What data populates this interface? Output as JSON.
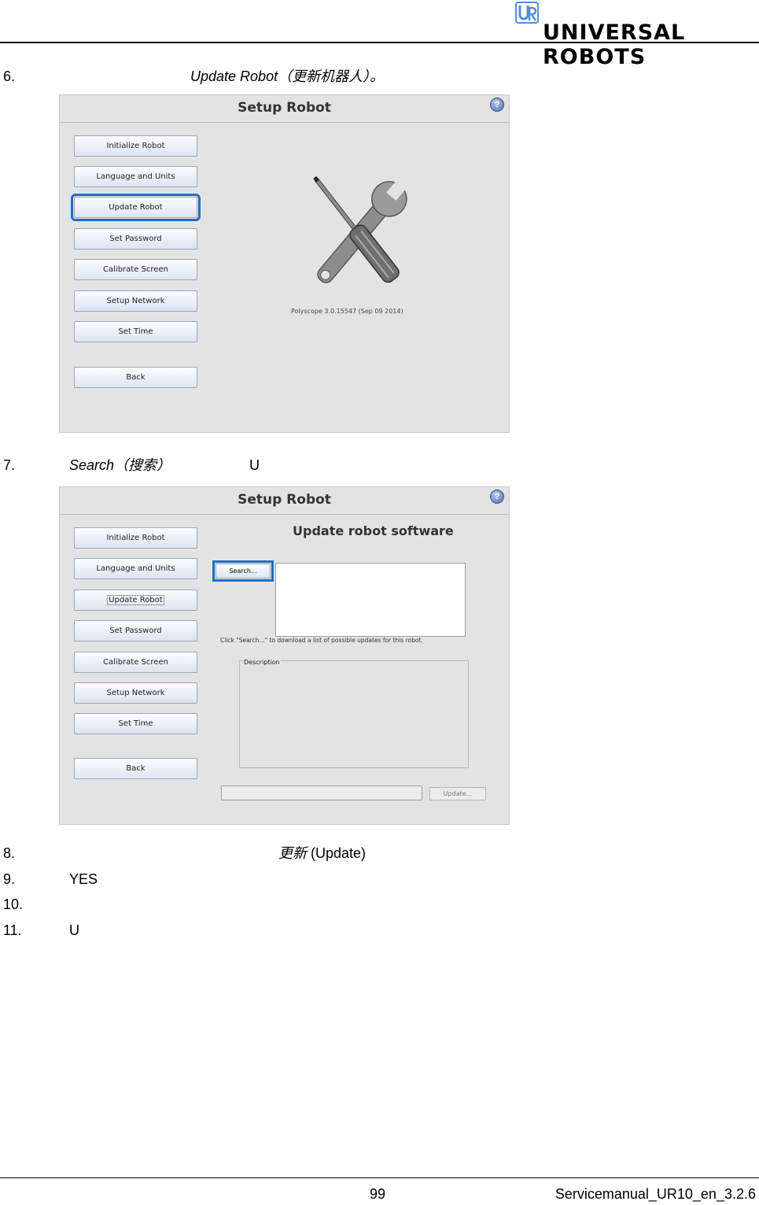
{
  "header": {
    "brand": "UNIVERSAL ROBOTS",
    "logo_icon": "ur-logo-icon"
  },
  "steps": {
    "s6": {
      "num": "6.",
      "italic": "Update Robot（更新机器人）。"
    },
    "s7": {
      "num": "7.",
      "italic": "Search（搜索）",
      "tail": "U"
    },
    "s8": {
      "num": "8.",
      "italic": "更新",
      "tail": " (Update)"
    },
    "s9": {
      "num": "9.",
      "text": "YES"
    },
    "s10": {
      "num": "10.",
      "text": ""
    },
    "s11": {
      "num": "11.",
      "text": "U"
    }
  },
  "screen1": {
    "title": "Setup Robot",
    "help": "?",
    "buttons": [
      "Initialize Robot",
      "Language and Units",
      "Update Robot",
      "Set Password",
      "Calibrate Screen",
      "Setup Network",
      "Set Time",
      "Back"
    ],
    "version": "Polyscope 3.0.15547 (Sep 09 2014)",
    "illustration_icon": "wrench-screwdriver-icon"
  },
  "screen2": {
    "title": "Setup Robot",
    "help": "?",
    "buttons": [
      "Initialize Robot",
      "Language and Units",
      "Update Robot",
      "Set Password",
      "Calibrate Screen",
      "Setup Network",
      "Set Time",
      "Back"
    ],
    "heading": "Update robot software",
    "search_label": "Search...",
    "hint": "Click \"Search...\" to download a list of possible updates for this robot.",
    "description_label": "Description",
    "update_label": "Update..."
  },
  "footer": {
    "page": "99",
    "doc_id": "Servicemanual_UR10_en_3.2.6"
  },
  "colors": {
    "highlight": "#1f6fc2",
    "panel_bg": "#e3e3e3"
  }
}
